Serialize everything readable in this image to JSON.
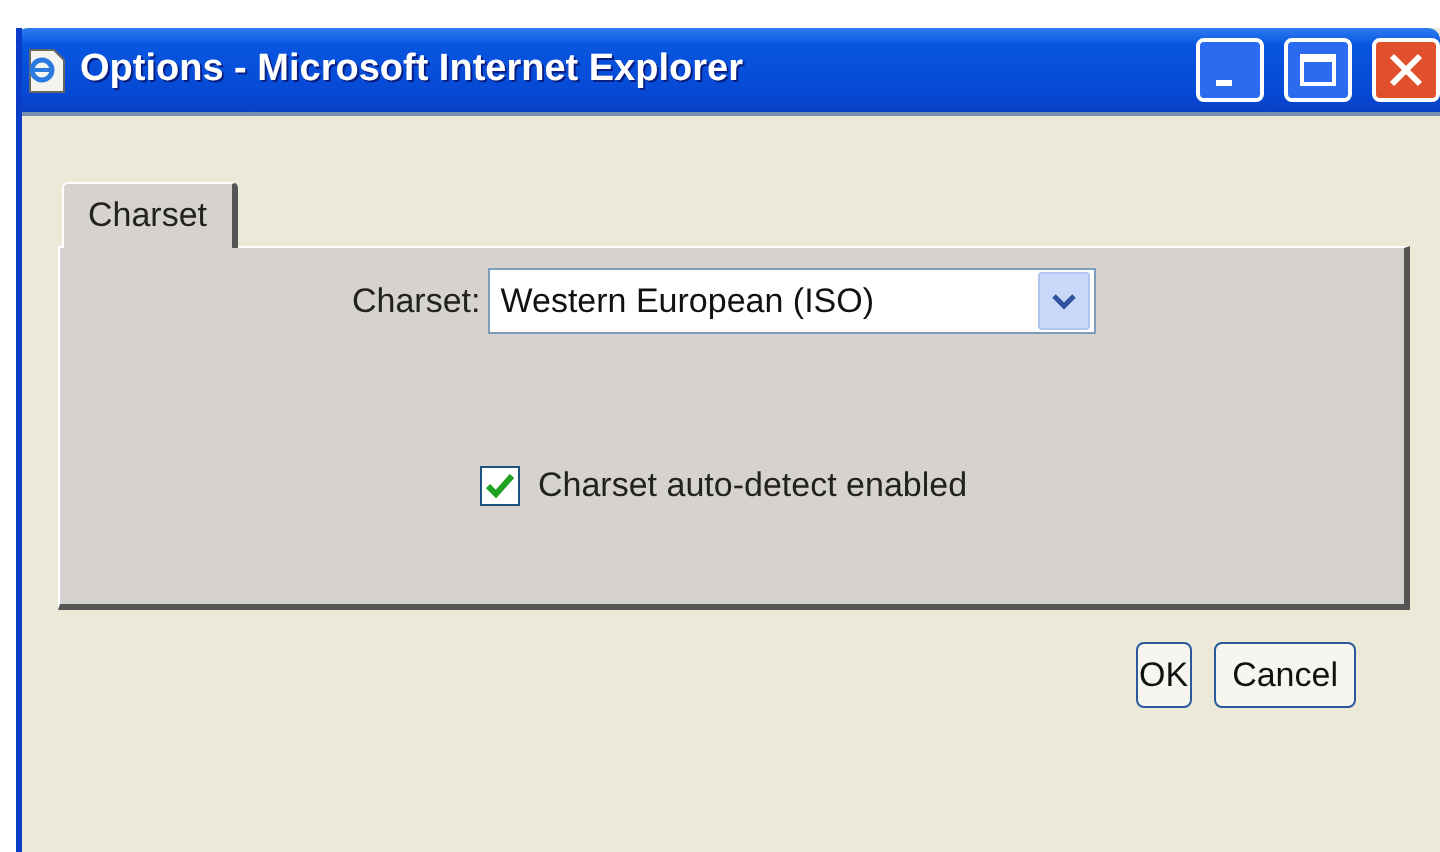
{
  "window": {
    "title": "Options - Microsoft Internet Explorer"
  },
  "tabs": [
    {
      "label": "Charset",
      "selected": true
    }
  ],
  "charset": {
    "label": "Charset:",
    "value": "Western European (ISO)"
  },
  "auto_detect": {
    "label": "Charset auto-detect enabled",
    "checked": true
  },
  "buttons": [
    "OK",
    "Cancel"
  ]
}
